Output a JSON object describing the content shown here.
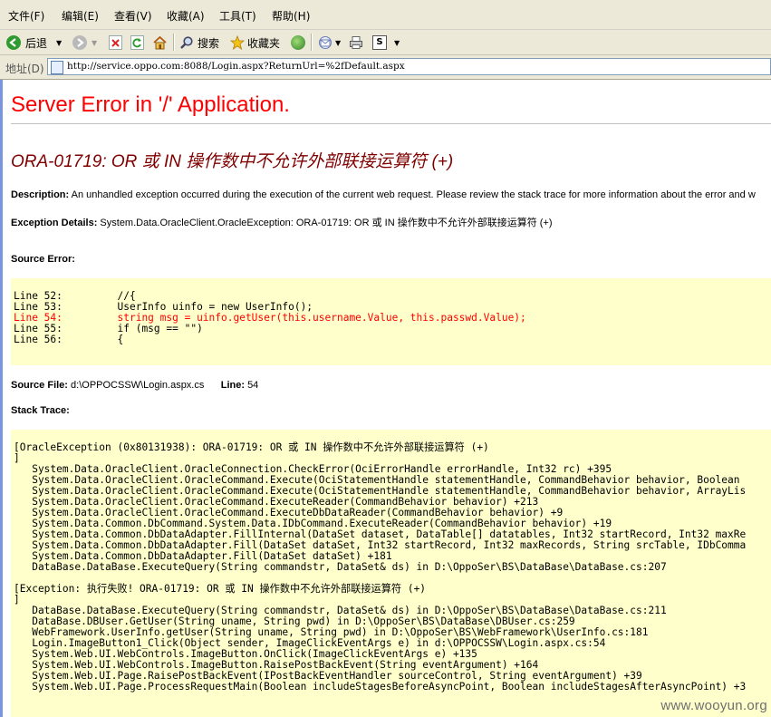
{
  "menu": [
    "文件(F)",
    "编辑(E)",
    "查看(V)",
    "收藏(A)",
    "工具(T)",
    "帮助(H)"
  ],
  "toolbar": {
    "back": "后退",
    "search": "搜索",
    "favorites": "收藏夹"
  },
  "address": {
    "label": "地址(D)",
    "url": "http://service.oppo.com:8088/Login.aspx?ReturnUrl=%2fDefault.aspx"
  },
  "page": {
    "title": "Server Error in '/' Application.",
    "error_title": "ORA-01719: OR 或 IN 操作数中不允许外部联接运算符 (+)",
    "description_label": "Description:",
    "description_text": "An unhandled exception occurred during the execution of the current web request. Please review the stack trace for more information about the error and w",
    "exception_label": "Exception Details:",
    "exception_text": "System.Data.OracleClient.OracleException: ORA-01719: OR 或 IN 操作数中不允许外部联接运算符 (+)",
    "source_error_label": "Source Error:",
    "source_lines": [
      "Line 52:         //{",
      "Line 53:         UserInfo uinfo = new UserInfo();",
      "Line 54:         string msg = uinfo.getUser(this.username.Value, this.passwd.Value);",
      "Line 55:         if (msg == \"\")",
      "Line 56:         {"
    ],
    "source_file_label": "Source File:",
    "source_file": "d:\\OPPOCSSW\\Login.aspx.cs",
    "line_label": "Line:",
    "line_number": "54",
    "stack_trace_label": "Stack Trace:",
    "stack_lines": [
      "[OracleException (0x80131938): ORA-01719: OR 或 IN 操作数中不允许外部联接运算符 (+)",
      "]",
      "   System.Data.OracleClient.OracleConnection.CheckError(OciErrorHandle errorHandle, Int32 rc) +395",
      "   System.Data.OracleClient.OracleCommand.Execute(OciStatementHandle statementHandle, CommandBehavior behavior, Boolean",
      "   System.Data.OracleClient.OracleCommand.Execute(OciStatementHandle statementHandle, CommandBehavior behavior, ArrayLis",
      "   System.Data.OracleClient.OracleCommand.ExecuteReader(CommandBehavior behavior) +213",
      "   System.Data.OracleClient.OracleCommand.ExecuteDbDataReader(CommandBehavior behavior) +9",
      "   System.Data.Common.DbCommand.System.Data.IDbCommand.ExecuteReader(CommandBehavior behavior) +19",
      "   System.Data.Common.DbDataAdapter.FillInternal(DataSet dataset, DataTable[] datatables, Int32 startRecord, Int32 maxRe",
      "   System.Data.Common.DbDataAdapter.Fill(DataSet dataSet, Int32 startRecord, Int32 maxRecords, String srcTable, IDbComma",
      "   System.Data.Common.DbDataAdapter.Fill(DataSet dataSet) +181",
      "   DataBase.DataBase.ExecuteQuery(String commandstr, DataSet& ds) in D:\\OppoSer\\BS\\DataBase\\DataBase.cs:207",
      "",
      "[Exception: 执行失败! ORA-01719: OR 或 IN 操作数中不允许外部联接运算符 (+)",
      "]",
      "   DataBase.DataBase.ExecuteQuery(String commandstr, DataSet& ds) in D:\\OppoSer\\BS\\DataBase\\DataBase.cs:211",
      "   DataBase.DBUser.GetUser(String uname, String pwd) in D:\\OppoSer\\BS\\DataBase\\DBUser.cs:259",
      "   WebFramework.UserInfo.getUser(String uname, String pwd) in D:\\OppoSer\\BS\\WebFramework\\UserInfo.cs:181",
      "   Login.ImageButton1_Click(Object sender, ImageClickEventArgs e) in d:\\OPPOCSSW\\Login.aspx.cs:54",
      "   System.Web.UI.WebControls.ImageButton.OnClick(ImageClickEventArgs e) +135",
      "   System.Web.UI.WebControls.ImageButton.RaisePostBackEvent(String eventArgument) +164",
      "   System.Web.UI.Page.RaisePostBackEvent(IPostBackEventHandler sourceControl, String eventArgument) +39",
      "   System.Web.UI.Page.ProcessRequestMain(Boolean includeStagesBeforeAsyncPoint, Boolean includeStagesAfterAsyncPoint) +3"
    ]
  },
  "watermark": "www.wooyun.org"
}
